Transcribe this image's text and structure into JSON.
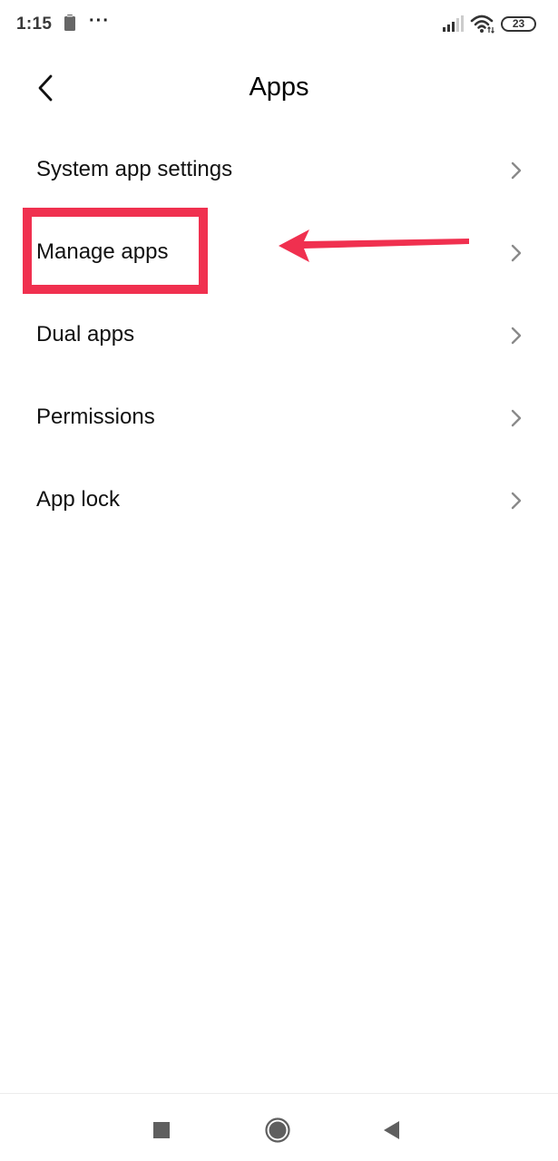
{
  "status_bar": {
    "time": "1:15",
    "overflow_indicator": "···",
    "battery_level": "23",
    "icons": [
      "clipboard-icon",
      "signal-icon",
      "wifi-icon",
      "battery-icon"
    ]
  },
  "header": {
    "title": "Apps",
    "back_icon": "chevron-left-icon"
  },
  "settings_list": {
    "items": [
      {
        "label": "System app settings",
        "icon": "chevron-right-icon"
      },
      {
        "label": "Manage apps",
        "icon": "chevron-right-icon",
        "highlighted": true
      },
      {
        "label": "Dual apps",
        "icon": "chevron-right-icon"
      },
      {
        "label": "Permissions",
        "icon": "chevron-right-icon"
      },
      {
        "label": "App lock",
        "icon": "chevron-right-icon"
      }
    ]
  },
  "annotation": {
    "color": "#f0304f",
    "target": "Manage apps"
  },
  "nav_bar": {
    "buttons": [
      "recents",
      "home",
      "back"
    ],
    "icon_color": "#5f5f5f"
  }
}
